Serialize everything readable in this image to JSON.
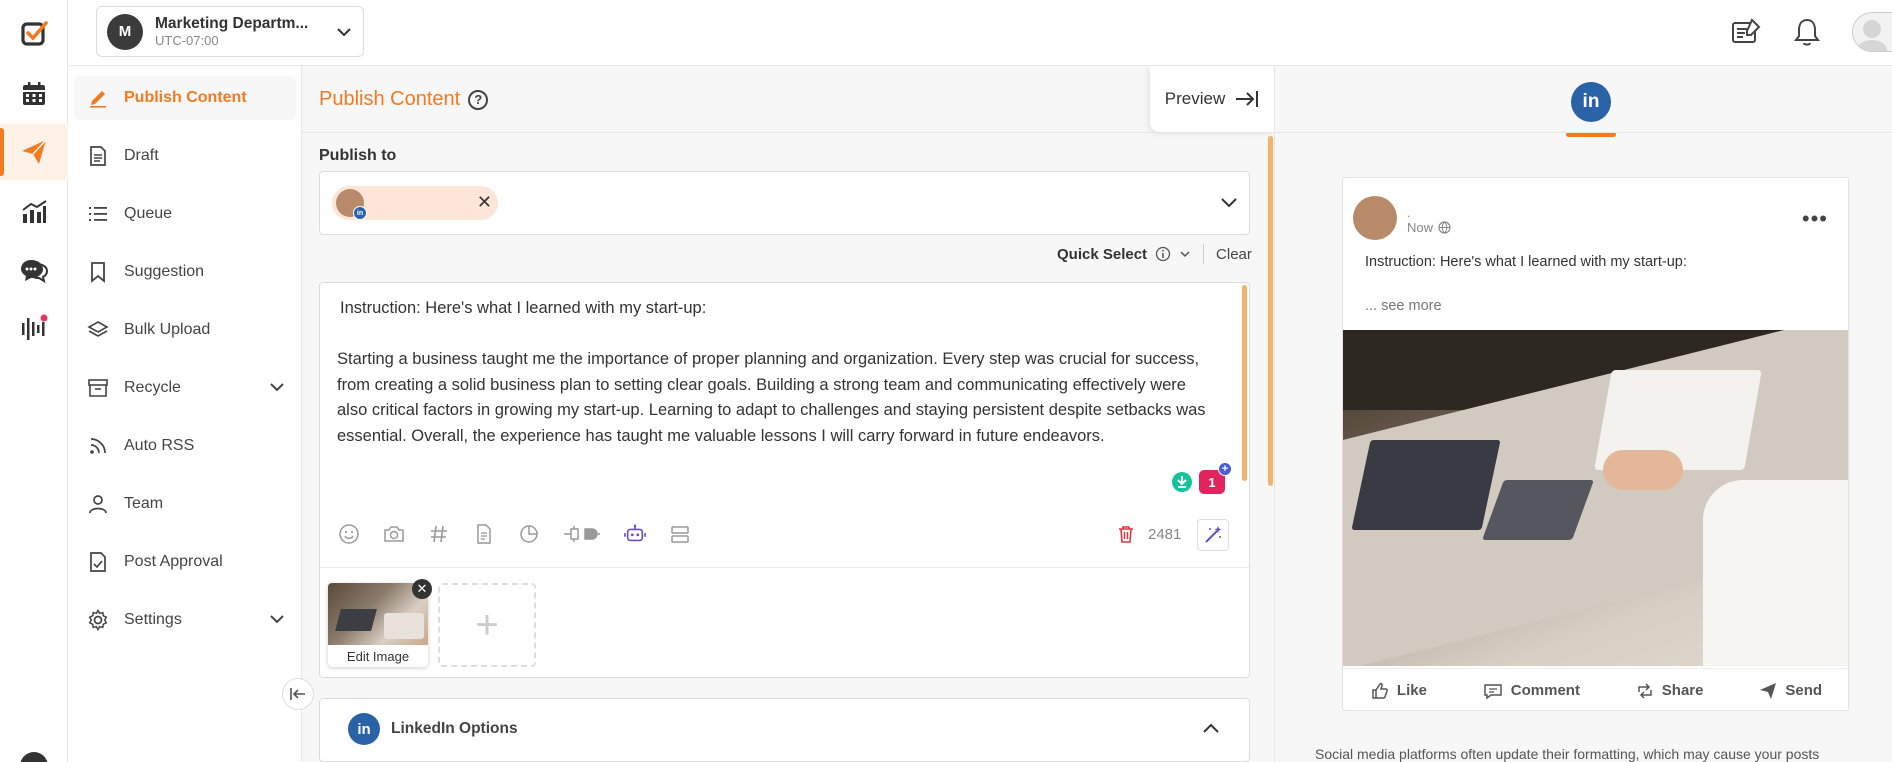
{
  "workspace": {
    "initial": "M",
    "name": "Marketing Departm...",
    "timezone": "UTC-07:00"
  },
  "sidebar": {
    "items": [
      {
        "label": "Publish Content"
      },
      {
        "label": "Draft"
      },
      {
        "label": "Queue"
      },
      {
        "label": "Suggestion"
      },
      {
        "label": "Bulk Upload"
      },
      {
        "label": "Recycle"
      },
      {
        "label": "Auto RSS"
      },
      {
        "label": "Team"
      },
      {
        "label": "Post Approval"
      },
      {
        "label": "Settings"
      }
    ]
  },
  "main": {
    "title": "Publish Content",
    "help_icon": "?",
    "preview_label": "Preview",
    "publish_to_label": "Publish to",
    "chip_badge": "in",
    "quick_select_label": "Quick Select",
    "clear_label": "Clear",
    "editor": {
      "instruction": "Instruction: Here's what I learned with my start-up:",
      "body": "Starting a business taught me the importance of proper planning and organization. Every step was crucial for success, from creating a solid business plan to setting clear goals. Building a strong team and communicating effectively were also critical factors in growing my start-up. Learning to adapt to challenges and staying persistent despite setbacks was essential. Overall, the experience has taught me valuable lessons I will carry forward in future endeavors.",
      "grammar_count": "1",
      "char_count": "2481",
      "edit_image_label": "Edit Image",
      "add_media_symbol": "+"
    },
    "linkedin_options_label": "LinkedIn Options",
    "linkedin_icon_text": "in"
  },
  "preview": {
    "network_icon_text": "in",
    "post": {
      "author_dot": ".",
      "time": "Now",
      "text": "Instruction: Here's what I learned with my start-up:",
      "see_more": "... see more",
      "actions": [
        "Like",
        "Comment",
        "Share",
        "Send"
      ]
    },
    "footnote": "Social media platforms often update their formatting, which may cause your posts"
  },
  "colors": {
    "accent": "#f47a20",
    "linkedin": "#2a62a8",
    "scrollbar": "#f4b36b"
  }
}
